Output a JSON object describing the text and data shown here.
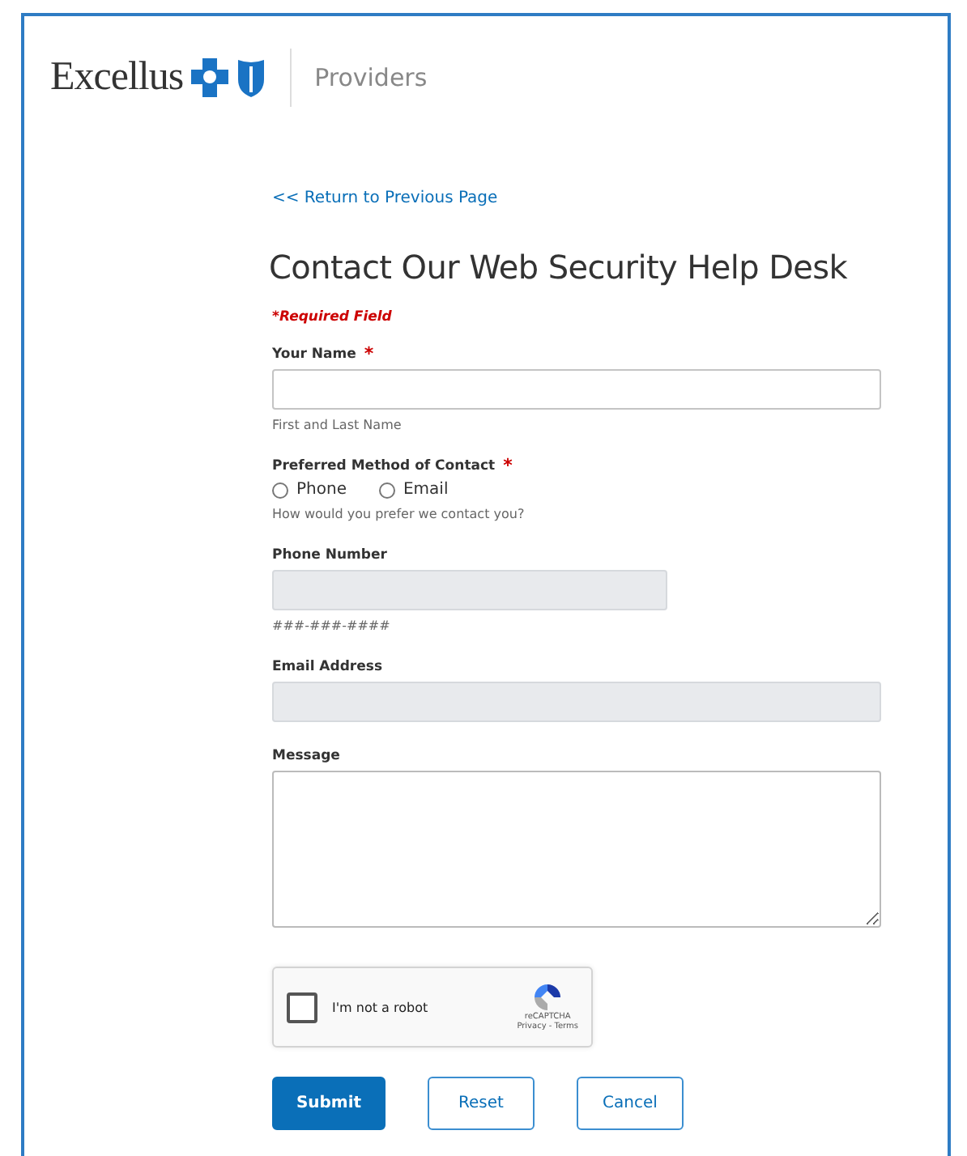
{
  "header": {
    "brand": "Excellus",
    "section": "Providers"
  },
  "back_link": "<< Return to Previous Page",
  "title": "Contact Our Web Security Help Desk",
  "required_note": "*Required Field",
  "fields": [
    {
      "kind": "text",
      "label": "Your Name",
      "marker": "*",
      "hint": "First and Last Name",
      "disabled": false
    },
    {
      "kind": "radio",
      "label": "Preferred Method of Contact",
      "marker": "*",
      "hint": "How would you prefer we contact you?",
      "options": [
        {
          "label": "Phone",
          "selected": false
        },
        {
          "label": "Email",
          "selected": false
        }
      ]
    },
    {
      "kind": "short_text",
      "label": "Phone Number",
      "hint": "###-###-####",
      "disabled": true
    },
    {
      "kind": "text",
      "label": "Email Address",
      "disabled": true
    },
    {
      "kind": "textarea",
      "label": "Message"
    }
  ],
  "captcha": {
    "label": "I'm not a robot",
    "checked": false,
    "brand": "reCAPTCHA",
    "links": "Privacy - Terms"
  },
  "buttons": [
    {
      "label": "Submit",
      "kind": "primary"
    },
    {
      "label": "Reset",
      "kind": "secondary"
    },
    {
      "label": "Cancel",
      "kind": "secondary"
    }
  ]
}
